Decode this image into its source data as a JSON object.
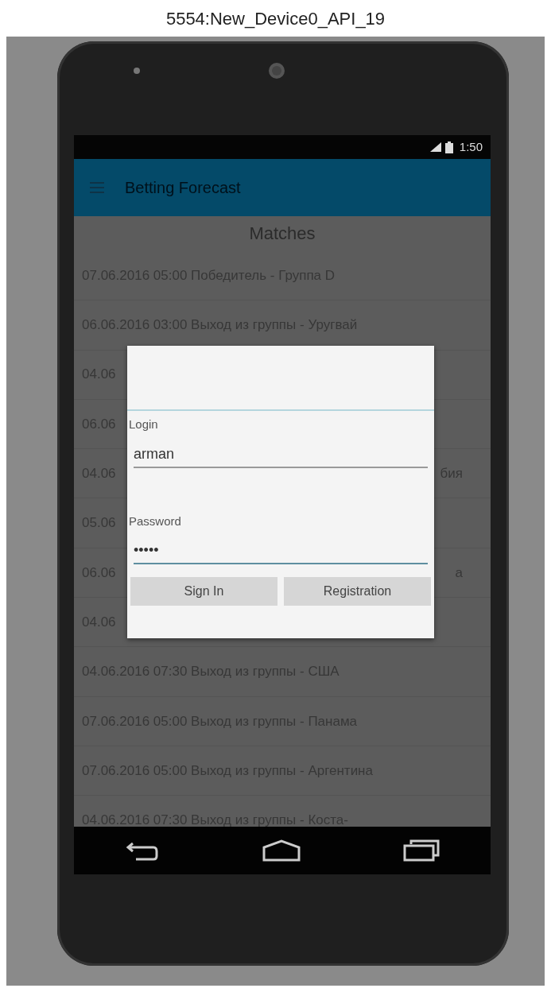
{
  "window": {
    "title": "5554:New_Device0_API_19"
  },
  "status_bar": {
    "time": "1:50"
  },
  "app_bar": {
    "title": "Betting Forecast"
  },
  "list": {
    "title": "Matches",
    "rows": [
      {
        "text": "07.06.2016 05:00 Победитель - Группа D"
      },
      {
        "text": "06.06.2016 03:00 Выход из группы - Уругвай"
      },
      {
        "text": "04.06"
      },
      {
        "text": "06.06"
      },
      {
        "text": "04.06",
        "tail": "бия"
      },
      {
        "text": "05.06"
      },
      {
        "text": "06.06",
        "tail": "а"
      },
      {
        "text": "04.06"
      },
      {
        "text": "04.06.2016 07:30 Выход из группы - США"
      },
      {
        "text": "07.06.2016 05:00 Выход из группы - Панама"
      },
      {
        "text": "07.06.2016 05:00 Выход из группы - Аргентина"
      },
      {
        "text": "04.06.2016 07:30 Выход из группы - Коста-"
      }
    ]
  },
  "dialog": {
    "fields": [
      {
        "label": "Login",
        "value": "arman",
        "focused": false
      },
      {
        "label": "Password",
        "value": "•••••",
        "focused": true
      }
    ],
    "buttons": [
      "Sign In",
      "Registration"
    ]
  }
}
